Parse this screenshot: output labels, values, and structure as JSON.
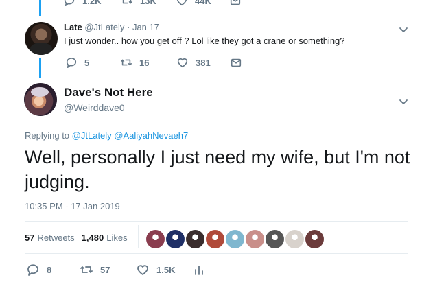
{
  "top_actions": {
    "replies": "1.2K",
    "retweets": "13K",
    "likes": "44K"
  },
  "reply": {
    "name": "Late",
    "handle": "@JtLately",
    "dot": "·",
    "date": "Jan 17",
    "text": "I just wonder.. how you get off ? Lol like they got a crane or something?",
    "replies": "5",
    "retweets": "16",
    "likes": "381"
  },
  "main": {
    "name": "Dave's Not Here",
    "handle": "@Weirddave0",
    "replying_prefix": "Replying to",
    "replying_to": [
      "@JtLately",
      "@AaliyahNevaeh7"
    ],
    "text": "Well, personally I just need my wife, but I'm not judging.",
    "timestamp": "10:35 PM - 17 Jan 2019",
    "retweet_count": "57",
    "retweet_label": "Retweets",
    "like_count": "1,480",
    "like_label": "Likes",
    "likers": [
      {
        "name": "liker-1",
        "color": "#8a3d4f"
      },
      {
        "name": "liker-2",
        "color": "#1f2f66"
      },
      {
        "name": "liker-3",
        "color": "#3a2d2d"
      },
      {
        "name": "liker-4",
        "color": "#b04a3a"
      },
      {
        "name": "liker-5",
        "color": "#7fb7cf"
      },
      {
        "name": "liker-6",
        "color": "#c98f8a"
      },
      {
        "name": "liker-7",
        "color": "#565656"
      },
      {
        "name": "liker-8",
        "color": "#d8d2cc"
      },
      {
        "name": "liker-9",
        "color": "#6b3b3b"
      }
    ],
    "actions": {
      "replies": "8",
      "retweets": "57",
      "likes": "1.5K"
    }
  },
  "icons": {
    "reply": "reply-icon",
    "retweet": "retweet-icon",
    "like": "heart-icon",
    "dm": "envelope-icon",
    "analytics": "analytics-icon",
    "more": "chevron-down-icon"
  },
  "colors": {
    "accent": "#1da1f2",
    "link": "#1b95e0",
    "muted": "#657786",
    "text": "#14171a"
  }
}
